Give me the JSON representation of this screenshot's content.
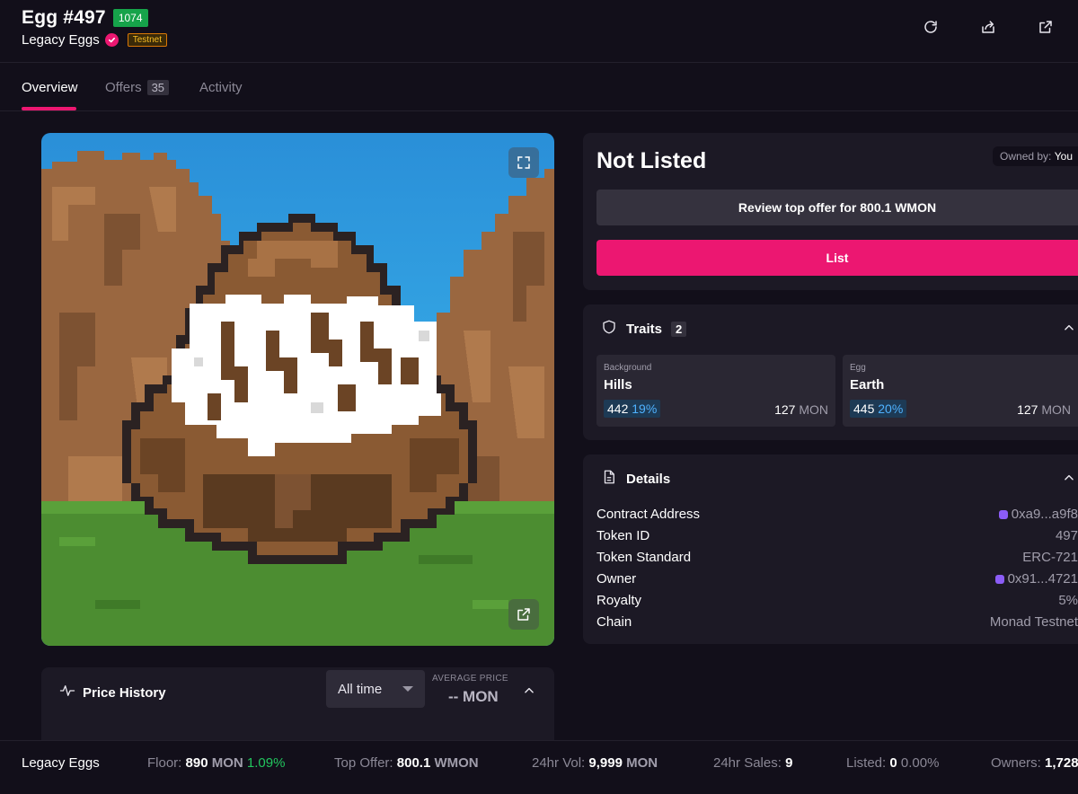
{
  "header": {
    "title": "Egg #497",
    "rank": "1074",
    "collection": "Legacy Eggs",
    "network_badge": "Testnet",
    "actions": [
      "refresh-icon",
      "share-icon",
      "external-link-icon"
    ]
  },
  "tabs": [
    {
      "label": "Overview",
      "active": true
    },
    {
      "label": "Offers",
      "count": "35"
    },
    {
      "label": "Activity"
    }
  ],
  "image": {
    "actions": [
      "expand-icon",
      "open-external-icon"
    ],
    "colors": {
      "sky_top": "#2a8fd8",
      "sky_bottom": "#3fb8f0",
      "hills": "#9a6740",
      "grass": "#4c8d31",
      "egg_brown": "#6b4425",
      "egg_white": "#ffffff"
    }
  },
  "price_history": {
    "title": "Price History",
    "range": "All time",
    "avg_label": "AVERAGE PRICE",
    "avg_value": "-- MON"
  },
  "listing": {
    "status": "Not Listed",
    "owned_by_label": "Owned by:",
    "owner": "You",
    "review_button": "Review top offer for 800.1 WMON",
    "list_button": "List"
  },
  "traits": {
    "title": "Traits",
    "count": "2",
    "items": [
      {
        "type": "Background",
        "value": "Hills",
        "count": "442",
        "percent": "19%",
        "price": "127",
        "unit": "MON"
      },
      {
        "type": "Egg",
        "value": "Earth",
        "count": "445",
        "percent": "20%",
        "price": "127",
        "unit": "MON"
      }
    ]
  },
  "details": {
    "title": "Details",
    "rows": [
      {
        "label": "Contract Address",
        "value": "0xa9...a9f8"
      },
      {
        "label": "Token ID",
        "value": "497"
      },
      {
        "label": "Token Standard",
        "value": "ERC-721"
      },
      {
        "label": "Owner",
        "value": "0x91...4721"
      },
      {
        "label": "Royalty",
        "value": "5%"
      },
      {
        "label": "Chain",
        "value": "Monad Testnet"
      }
    ]
  },
  "footer": {
    "collection": "Legacy Eggs",
    "floor_label": "Floor:",
    "floor_value": "890",
    "floor_unit": "MON",
    "floor_change": "1.09%",
    "top_offer_label": "Top Offer:",
    "top_offer_value": "800.1",
    "top_offer_unit": "WMON",
    "vol_label": "24hr Vol:",
    "vol_value": "9,999",
    "vol_unit": "MON",
    "sales_label": "24hr Sales:",
    "sales_value": "9",
    "listed_label": "Listed:",
    "listed_value": "0",
    "listed_pct": "0.00%",
    "owners_label": "Owners:",
    "owners_value": "1,728"
  }
}
